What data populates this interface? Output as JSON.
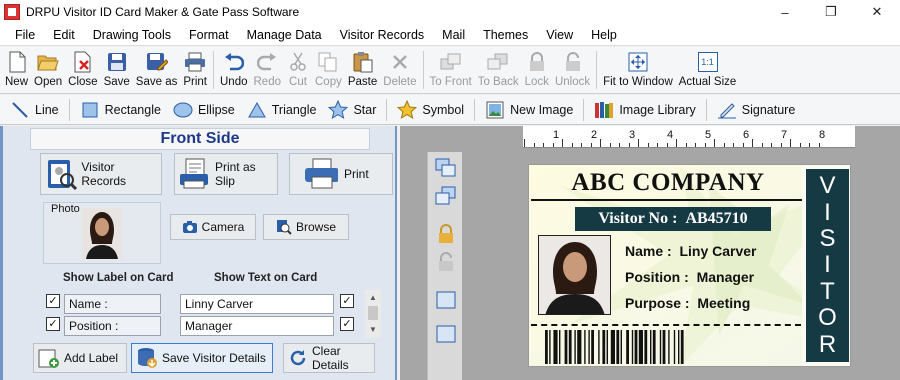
{
  "window": {
    "title": "DRPU Visitor ID Card Maker & Gate Pass Software",
    "minimize": "–",
    "maximize": "❐",
    "close": "✕"
  },
  "menu": [
    "File",
    "Edit",
    "Drawing Tools",
    "Format",
    "Manage Data",
    "Visitor Records",
    "Mail",
    "Themes",
    "View",
    "Help"
  ],
  "toolbar": {
    "new": "New",
    "open": "Open",
    "close": "Close",
    "save": "Save",
    "save_as": "Save as",
    "print": "Print",
    "undo": "Undo",
    "redo": "Redo",
    "cut": "Cut",
    "copy": "Copy",
    "paste": "Paste",
    "delete": "Delete",
    "to_front": "To Front",
    "to_back": "To Back",
    "lock": "Lock",
    "unlock": "Unlock",
    "fit_to_window": "Fit to Window",
    "actual_size": "Actual Size",
    "actual_size_icon": "1:1"
  },
  "drawing_tools": {
    "line": "Line",
    "rectangle": "Rectangle",
    "ellipse": "Ellipse",
    "triangle": "Triangle",
    "star": "Star",
    "symbol": "Symbol",
    "new_image": "New Image",
    "image_library": "Image Library",
    "signature": "Signature"
  },
  "panel": {
    "heading": "Front Side",
    "visitor_records": "Visitor Records",
    "print_as_slip": "Print as Slip",
    "print": "Print",
    "photo_label": "Photo",
    "camera": "Camera",
    "browse": "Browse",
    "show_label_header": "Show Label on Card",
    "show_text_header": "Show Text on Card",
    "rows": [
      {
        "label": "Name :",
        "text": "Linny Carver",
        "label_checked": "✓",
        "text_checked": "✓"
      },
      {
        "label": "Position :",
        "text": "Manager",
        "label_checked": "✓",
        "text_checked": "✓"
      }
    ],
    "add_label": "Add Label",
    "save_visitor_details": "Save Visitor Details",
    "clear_details": "Clear Details"
  },
  "ruler": [
    "1",
    "2",
    "3",
    "4",
    "5",
    "6",
    "7",
    "8"
  ],
  "card": {
    "company": "ABC COMPANY",
    "visitor_no_label": "Visitor No :",
    "visitor_no_value": "AB45710",
    "name_key": "Name :",
    "name_value": "Liny Carver",
    "position_key": "Position :",
    "position_value": "Manager",
    "purpose_key": "Purpose :",
    "purpose_value": "Meeting",
    "vertical_text": [
      "V",
      "I",
      "S",
      "I",
      "T",
      "O",
      "R"
    ],
    "band_color": "#163a44"
  },
  "colors": {
    "accent": "#1d3a8a",
    "panel_border": "#6f96c7",
    "canvas_bg": "#a6a6a6"
  }
}
